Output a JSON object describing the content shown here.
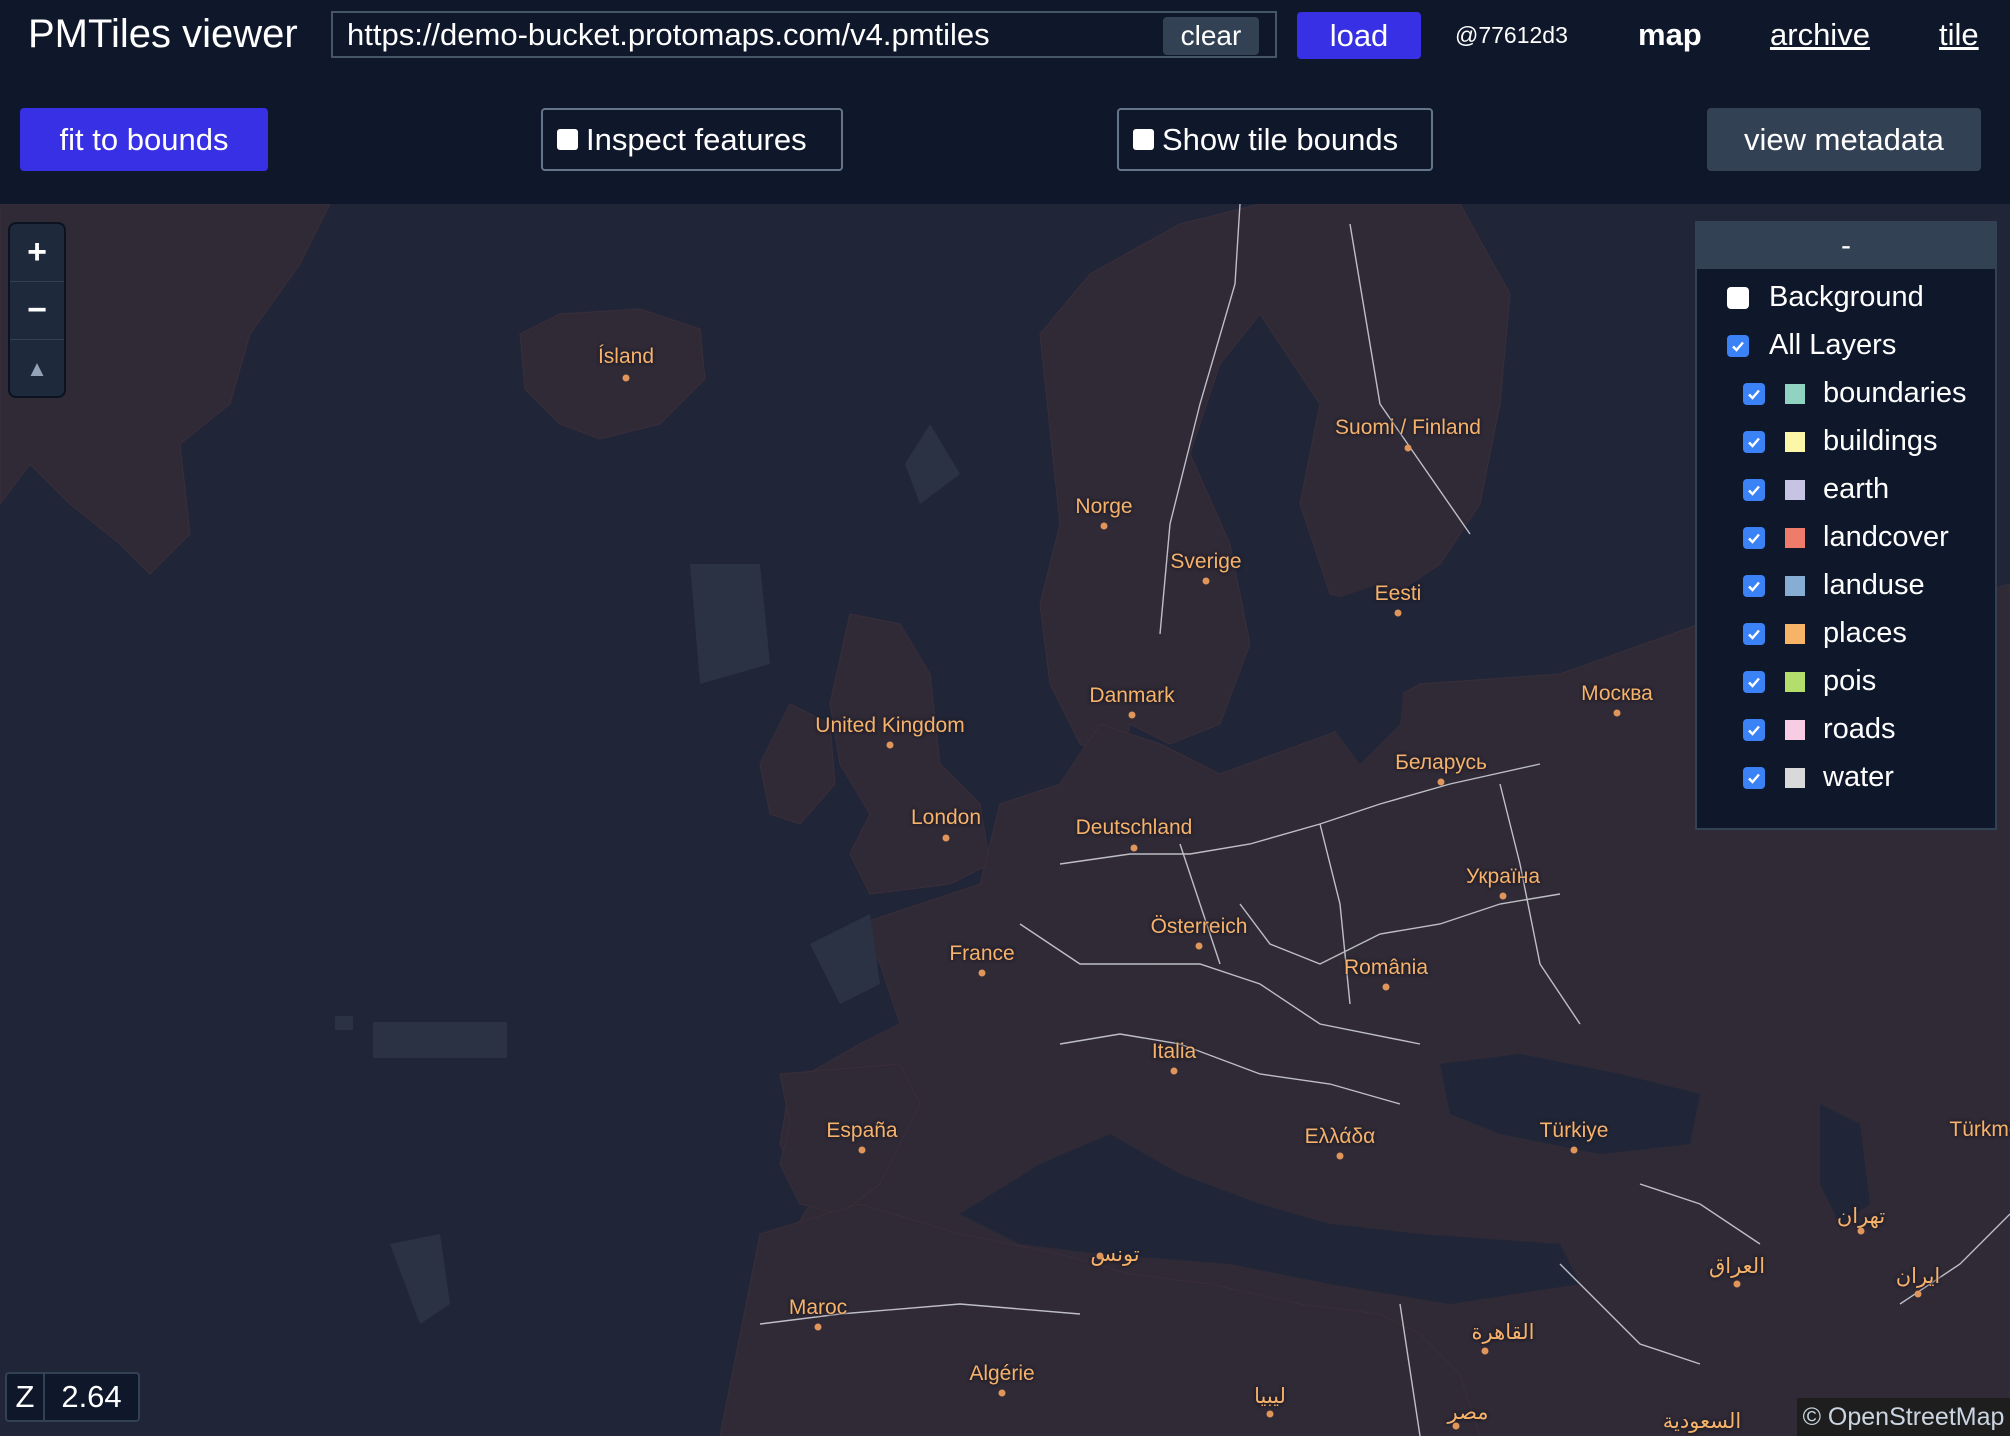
{
  "app": {
    "title": "PMTiles viewer"
  },
  "url": {
    "value": "https://demo-bucket.protomaps.com/v4.pmtiles"
  },
  "toolbar": {
    "clear_label": "clear",
    "load_label": "load",
    "version": "@77612d3",
    "nav": {
      "map": "map",
      "archive": "archive",
      "tile": "tile"
    },
    "fit_label": "fit to bounds",
    "inspect_label": "Inspect features",
    "tile_bounds_label": "Show tile bounds",
    "metadata_label": "view metadata"
  },
  "map_controls": {
    "zoom_in": "+",
    "zoom_out": "−",
    "compass": "▲"
  },
  "layers_panel": {
    "collapse_label": "-",
    "background_label": "Background",
    "all_layers_label": "All Layers",
    "layers": [
      {
        "name": "boundaries",
        "color": "#8fd3c0"
      },
      {
        "name": "buildings",
        "color": "#fbf7a6"
      },
      {
        "name": "earth",
        "color": "#c7c3e2"
      },
      {
        "name": "landcover",
        "color": "#ef7b6b"
      },
      {
        "name": "landuse",
        "color": "#86add2"
      },
      {
        "name": "places",
        "color": "#f8b466"
      },
      {
        "name": "pois",
        "color": "#b4de6c"
      },
      {
        "name": "roads",
        "color": "#f8cde3"
      },
      {
        "name": "water",
        "color": "#d9d9d9"
      }
    ]
  },
  "places": [
    "Ísland",
    "Suomi / Finland",
    "Norge",
    "Sverige",
    "Eesti",
    "Danmark",
    "Москва",
    "United Kingdom",
    "Беларусь",
    "London",
    "Deutschland",
    "Україна",
    "Österreich",
    "France",
    "România",
    "Italia",
    "España",
    "Ελλάδα",
    "Türkiye",
    "Türkme",
    "تهران",
    "تونس",
    "العراق",
    "ایران",
    "Maroc",
    "القاهرة",
    "Algérie",
    "ليبيا",
    "مصر",
    "السعودية"
  ],
  "status": {
    "zoom_label": "Z",
    "zoom_value": "2.64",
    "attribution": "© OpenStreetMap"
  }
}
